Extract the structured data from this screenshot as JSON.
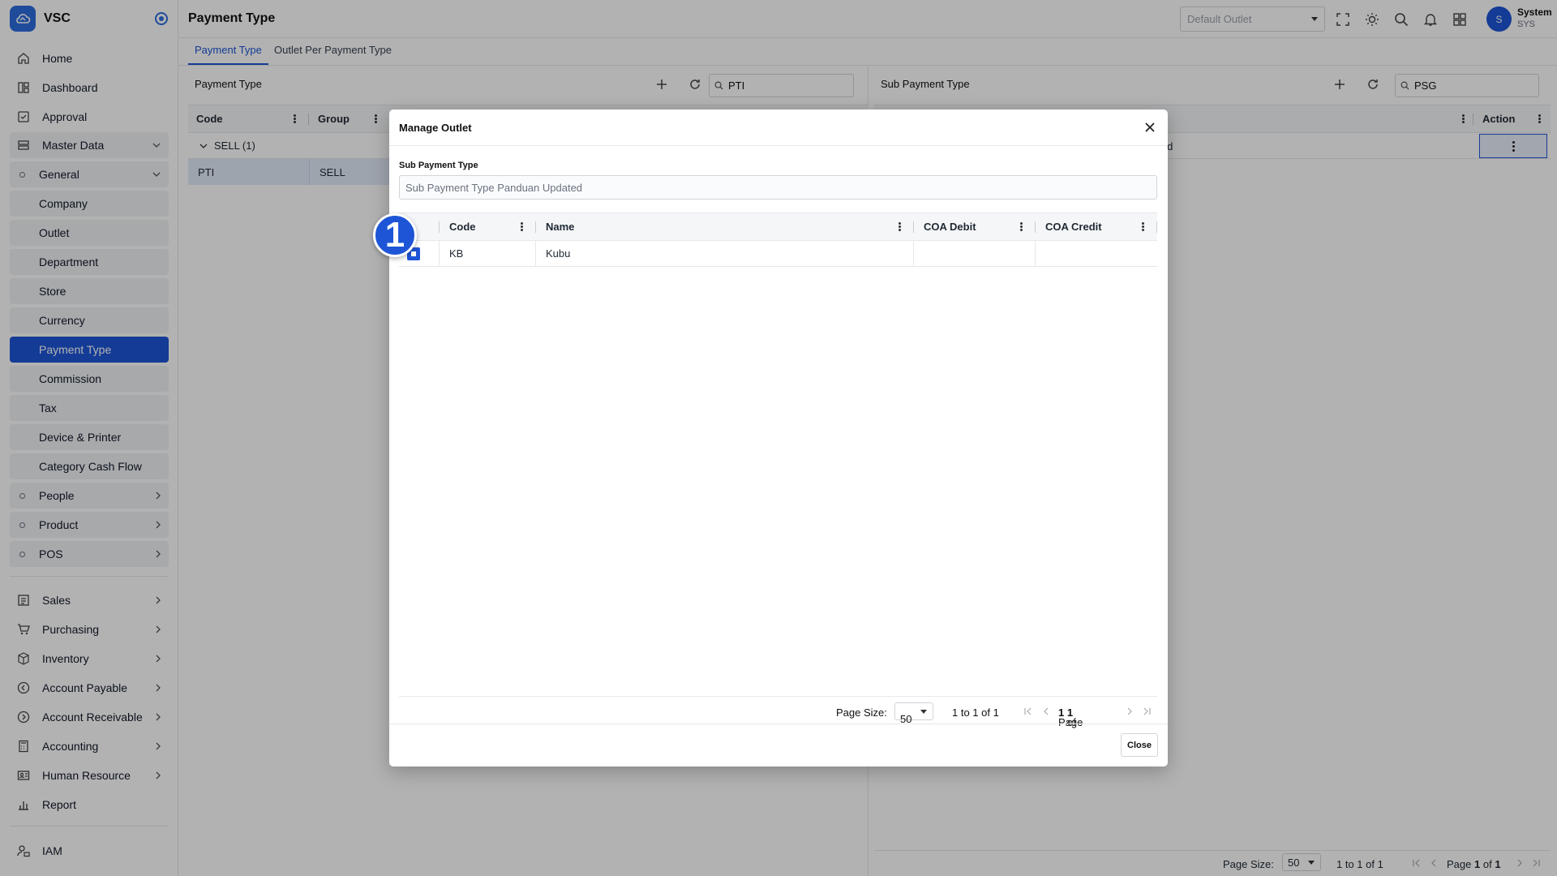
{
  "app": {
    "name": "VSC"
  },
  "sidebar": {
    "items": [
      {
        "label": "Home"
      },
      {
        "label": "Dashboard"
      },
      {
        "label": "Approval"
      },
      {
        "label": "Master Data"
      },
      {
        "label": "General"
      },
      {
        "label": "Company"
      },
      {
        "label": "Outlet"
      },
      {
        "label": "Department"
      },
      {
        "label": "Store"
      },
      {
        "label": "Currency"
      },
      {
        "label": "Payment Type"
      },
      {
        "label": "Commission"
      },
      {
        "label": "Tax"
      },
      {
        "label": "Device & Printer"
      },
      {
        "label": "Category Cash Flow"
      },
      {
        "label": "People"
      },
      {
        "label": "Product"
      },
      {
        "label": "POS"
      },
      {
        "label": "Sales"
      },
      {
        "label": "Purchasing"
      },
      {
        "label": "Inventory"
      },
      {
        "label": "Account Payable"
      },
      {
        "label": "Account Receivable"
      },
      {
        "label": "Accounting"
      },
      {
        "label": "Human Resource"
      },
      {
        "label": "Report"
      },
      {
        "label": "IAM"
      }
    ]
  },
  "header": {
    "title": "Payment Type",
    "outlet_placeholder": "Default Outlet",
    "user": {
      "initial": "S",
      "name": "System",
      "code": "SYS"
    }
  },
  "tabs": [
    {
      "label": "Payment Type",
      "active": true
    },
    {
      "label": "Outlet Per Payment Type",
      "active": false
    }
  ],
  "left_panel": {
    "title": "Payment Type",
    "search_value": "PTI",
    "columns": [
      "Code",
      "Group"
    ],
    "group_row": "SELL (1)",
    "rows": [
      {
        "code": "PTI",
        "group": "SELL"
      }
    ]
  },
  "right_panel": {
    "title": "Sub Payment Type",
    "search_value": "PSG",
    "columns": [
      "Action"
    ],
    "row_partial_text": "ated",
    "pager": {
      "page_size_label": "Page Size:",
      "page_size": "50",
      "range": "1 to 1 of 1",
      "page_label": "Page",
      "page": "1",
      "of_label": "of",
      "total": "1"
    }
  },
  "modal": {
    "title": "Manage Outlet",
    "field_label": "Sub Payment Type",
    "field_value": "Sub Payment Type Panduan Updated",
    "columns": [
      "Code",
      "Name",
      "COA Debit",
      "COA Credit"
    ],
    "rows": [
      {
        "code": "KB",
        "name": "Kubu",
        "coa_debit": "",
        "coa_credit": ""
      }
    ],
    "pager": {
      "page_size_label": "Page Size:",
      "page_size": "50",
      "range": "1 to 1 of 1",
      "page_label": "Page",
      "page": "1",
      "of_label": "of",
      "total": "1"
    },
    "close_label": "Close",
    "step_badge": "1"
  },
  "colors": {
    "accent": "#1e55d6",
    "overlay": "rgba(0,0,0,0.3)"
  }
}
